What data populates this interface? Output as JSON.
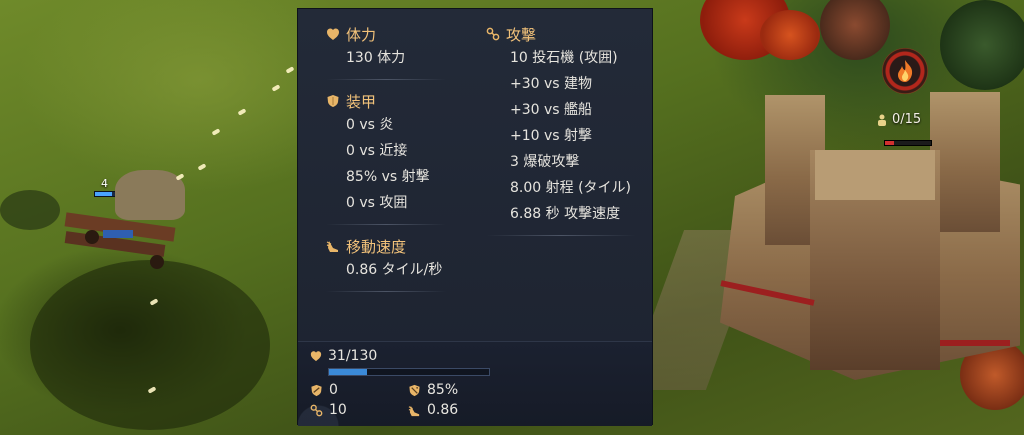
{
  "tooltip": {
    "health": {
      "heading": "体力",
      "value": "130 体力"
    },
    "armor": {
      "heading": "装甲",
      "lines": [
        "0 vs 炎",
        "0 vs 近接",
        "85% vs 射撃",
        "0 vs 攻囲"
      ]
    },
    "speed": {
      "heading": "移動速度",
      "value": "0.86 タイル/秒"
    },
    "attack": {
      "heading": "攻撃",
      "lines": [
        "10 投石機 (攻囲)",
        "+30 vs 建物",
        "+30 vs 艦船",
        "+10 vs 射撃",
        "3 爆破攻撃",
        "8.00 射程 (タイル)",
        "6.88 秒 攻撃速度"
      ]
    }
  },
  "unit_panel": {
    "hp_text": "31/130",
    "hp_fraction": 0.238,
    "melee_armor": "0",
    "ranged_armor": "85%",
    "attack": "10",
    "speed": "0.86"
  },
  "world": {
    "garrison": "0/15",
    "unit_count": "4"
  },
  "colors": {
    "heading": "#f2c27a",
    "panel_bg": "#1d2330",
    "hp_fill": "#3b8ad8",
    "badge_red": "#b2271c"
  },
  "icons": {
    "health": "heart-shield-icon",
    "armor": "shield-icon",
    "speed": "winged-boot-icon",
    "attack": "crossed-swords-icon",
    "fire": "fire-icon",
    "villager": "villager-icon"
  }
}
